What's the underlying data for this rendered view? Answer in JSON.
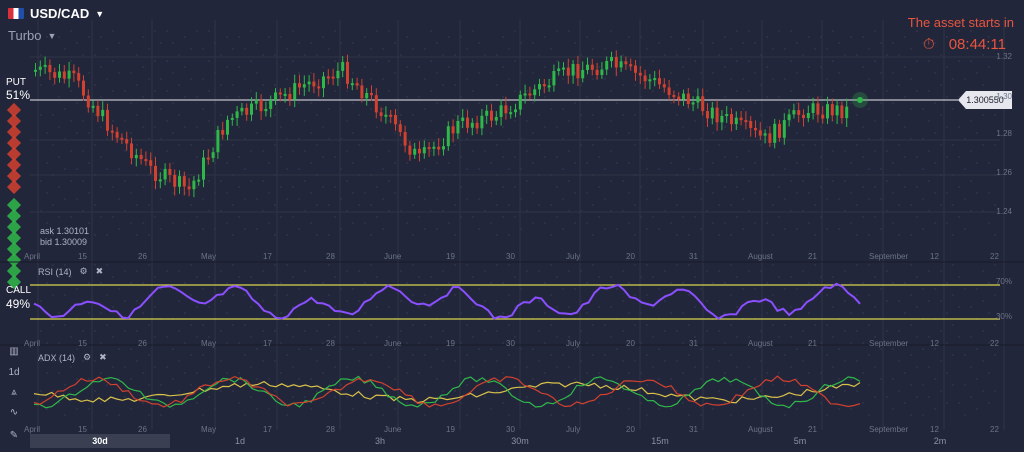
{
  "header": {
    "symbol": "USD/CAD",
    "mode": "Turbo"
  },
  "countdown": {
    "label": "The asset starts in",
    "time": "08:44:11"
  },
  "put": {
    "label": "PUT",
    "percent": "51%"
  },
  "call": {
    "label": "CALL",
    "percent": "49%"
  },
  "quote": {
    "ask": "ask 1.30101",
    "bid": "bid 1.30009",
    "current": "1.300550"
  },
  "y_axis": [
    "1.32",
    "1.30",
    "1.28",
    "1.26",
    "1.24"
  ],
  "x_axis": [
    "April",
    "15",
    "26",
    "May",
    "17",
    "28",
    "June",
    "19",
    "30",
    "July",
    "20",
    "31",
    "August",
    "21",
    "September",
    "12",
    "22"
  ],
  "rsi": {
    "label": "RSI (14)",
    "upper": "70%",
    "lower": "30%"
  },
  "adx": {
    "label": "ADX (14)"
  },
  "tools": [
    "1d"
  ],
  "time_periods": [
    "30d",
    "1d",
    "3h",
    "30m",
    "15m",
    "5m",
    "2m"
  ],
  "selected_period": "30d",
  "colors": {
    "bg": "#22263a",
    "up": "#2fb84a",
    "down": "#d2412f",
    "rsi": "#8a4fff",
    "level": "#d9d34a",
    "timer": "#e8553f"
  },
  "chart_data": {
    "type": "candlestick",
    "current_price": 1.30055,
    "ylim": [
      1.23,
      1.33
    ],
    "rsi_levels": [
      70,
      30
    ]
  }
}
